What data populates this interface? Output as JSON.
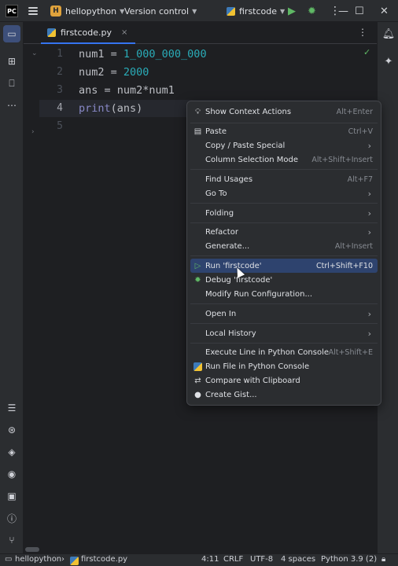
{
  "titlebar": {
    "logo": "PC",
    "project_badge": "H",
    "project_name": "hellopython",
    "vcs_label": "Version control",
    "run_config": "firstcode",
    "minimize": "—",
    "maximize": "☐",
    "close": "✕"
  },
  "tab": {
    "filename": "firstcode.py",
    "close": "×",
    "more": "⋮"
  },
  "editor": {
    "line_numbers": [
      "1",
      "2",
      "3",
      "4",
      "5"
    ],
    "lines": [
      {
        "var": "num1",
        "op": " = ",
        "val": "1_000_000_000"
      },
      {
        "var": "num2",
        "op": " = ",
        "val": "2000"
      },
      {
        "text": "ans = num2*num1"
      },
      {
        "fn": "print",
        "rest": "(ans)"
      }
    ],
    "check": "✓"
  },
  "context_menu": {
    "items": [
      {
        "label": "Show Context Actions",
        "shortcut": "Alt+Enter",
        "icon": "bulb-icon"
      },
      {
        "label": "Paste",
        "shortcut": "Ctrl+V",
        "icon": "paste-icon"
      },
      {
        "label": "Copy / Paste Special",
        "submenu": "›"
      },
      {
        "label": "Column Selection Mode",
        "shortcut": "Alt+Shift+Insert"
      },
      {
        "label": "Find Usages",
        "shortcut": "Alt+F7"
      },
      {
        "label": "Go To",
        "submenu": "›"
      },
      {
        "label": "Folding",
        "submenu": "›"
      },
      {
        "label": "Refactor",
        "submenu": "›"
      },
      {
        "label": "Generate...",
        "shortcut": "Alt+Insert"
      },
      {
        "label": "Run 'firstcode'",
        "shortcut": "Ctrl+Shift+F10",
        "icon": "run-icon"
      },
      {
        "label": "Debug 'firstcode'",
        "icon": "debug-icon"
      },
      {
        "label": "Modify Run Configuration..."
      },
      {
        "label": "Open In",
        "submenu": "›"
      },
      {
        "label": "Local History",
        "submenu": "›"
      },
      {
        "label": "Execute Line in Python Console",
        "shortcut": "Alt+Shift+E"
      },
      {
        "label": "Run File in Python Console",
        "icon": "python-icon"
      },
      {
        "label": "Compare with Clipboard",
        "icon": "compare-icon"
      },
      {
        "label": "Create Gist...",
        "icon": "github-icon"
      }
    ]
  },
  "status": {
    "project": "hellopython",
    "sep": "›",
    "file": "firstcode.py",
    "position": "4:11",
    "line_sep": "CRLF",
    "encoding": "UTF-8",
    "indent": "4 spaces",
    "interpreter": "Python 3.9 (2)"
  },
  "colors": {
    "accent": "#3574f0",
    "selection": "#2e436e",
    "number": "#2aacb8",
    "builtin": "#8888c6",
    "run_green": "#5fb865"
  }
}
